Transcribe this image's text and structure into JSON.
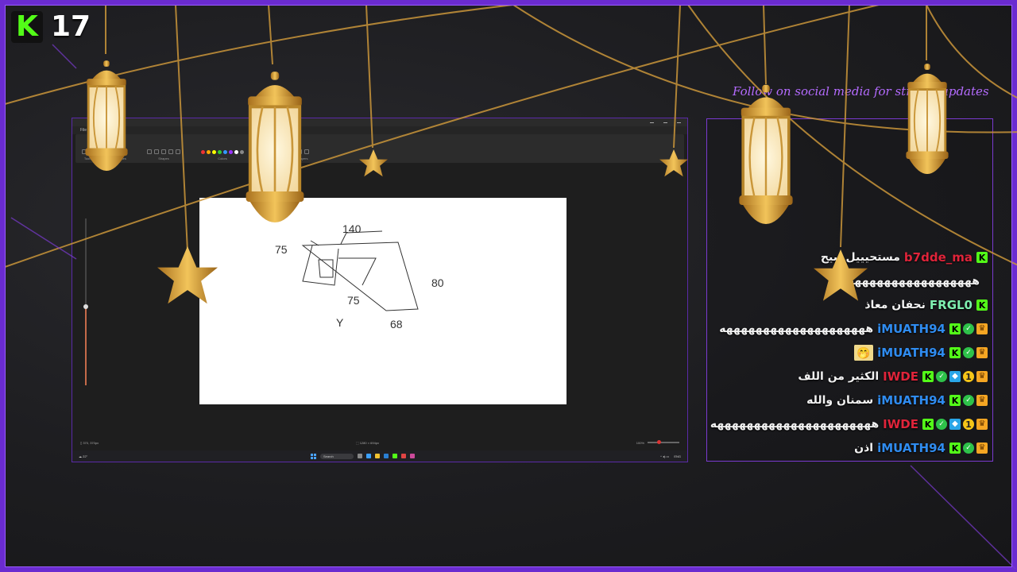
{
  "viewer_badge": {
    "logo": "K",
    "count": "17"
  },
  "social_text": "Follow on social media for stream updates",
  "colors": {
    "frame": "#6a2bd0",
    "kick_green": "#53fc18",
    "lantern_gold": "#d9a23a"
  },
  "capture": {
    "ribbon_groups": [
      "Tools",
      "Brushes",
      "Shapes",
      "Colors",
      "Copilot",
      "Layers"
    ],
    "canvas_sketch_labels": [
      "140",
      "75",
      "75",
      "80",
      "68",
      "Y"
    ],
    "taskbar": {
      "search_placeholder": "Search"
    }
  },
  "chat": {
    "messages": [
      {
        "badges": [
          "k"
        ],
        "user": "b7dde_ma",
        "user_color": "#e0243a",
        "text": "مستحيييل يبيح",
        "emote": ""
      },
      {
        "badges": [],
        "user": "",
        "user_color": "#ffffff",
        "text": "ههههههههههههههههههه",
        "emote": ""
      },
      {
        "badges": [
          "k"
        ],
        "user": "FRGL0",
        "user_color": "#7ff0b0",
        "text": "نحفان معاذ",
        "emote": ""
      },
      {
        "badges": [
          "k",
          "check",
          "crown"
        ],
        "user": "iMUATH94",
        "user_color": "#2f8cf0",
        "text": "ههههههههههههههههههههه",
        "emote": ""
      },
      {
        "badges": [
          "k",
          "check",
          "crown"
        ],
        "user": "iMUATH94",
        "user_color": "#2f8cf0",
        "text": "",
        "emote": "🤭"
      },
      {
        "badges": [
          "k",
          "check",
          "cube",
          "one",
          "crown"
        ],
        "user": "IWDE",
        "user_color": "#e0243a",
        "text": "الكثير من اللف",
        "emote": ""
      },
      {
        "badges": [
          "k",
          "check",
          "crown"
        ],
        "user": "iMUATH94",
        "user_color": "#2f8cf0",
        "text": "سمنان والله",
        "emote": ""
      },
      {
        "badges": [
          "k",
          "check",
          "cube",
          "one",
          "crown"
        ],
        "user": "IWDE",
        "user_color": "#e0243a",
        "text": "ههههههههههههههههههههههه",
        "emote": ""
      },
      {
        "badges": [
          "k",
          "check",
          "crown"
        ],
        "user": "iMUATH94",
        "user_color": "#2f8cf0",
        "text": "اذن",
        "emote": ""
      }
    ]
  }
}
